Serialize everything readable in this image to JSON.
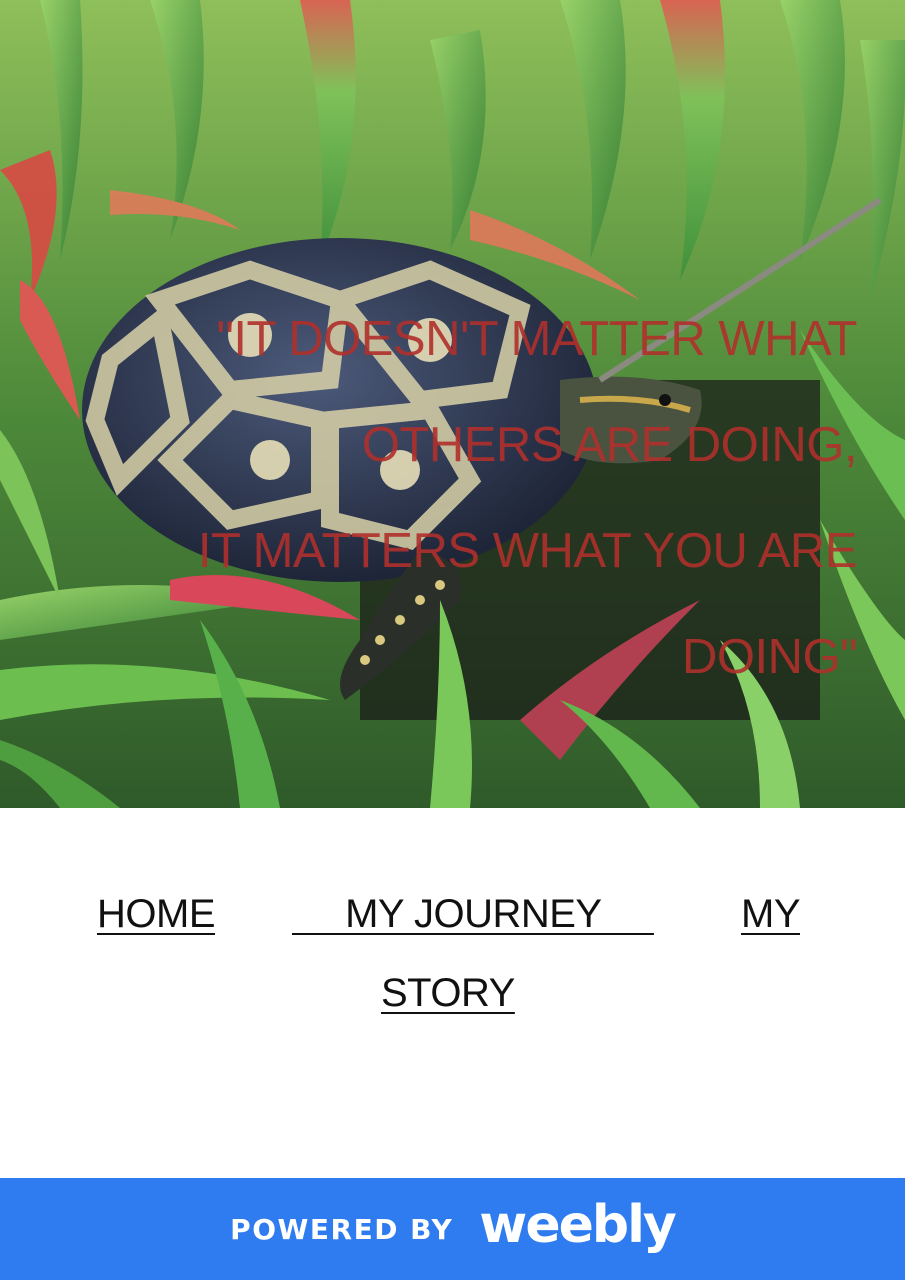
{
  "hero": {
    "image_alt": "Tortoise walking among green succulent plants",
    "quote_lines": [
      "\"IT DOESN'T MATTER WHAT",
      "OTHERS ARE DOING,",
      "IT MATTERS WHAT YOU ARE",
      "DOING\""
    ],
    "quote_color": "#b0302c"
  },
  "nav": {
    "home": "HOME",
    "my_journey": "     MY JOURNEY     ",
    "my_story_line1": "MY",
    "my_story_line2": "STORY"
  },
  "footer": {
    "powered_by": "POWERED BY",
    "brand": "weebly",
    "bg_color": "#2f7cf0"
  }
}
